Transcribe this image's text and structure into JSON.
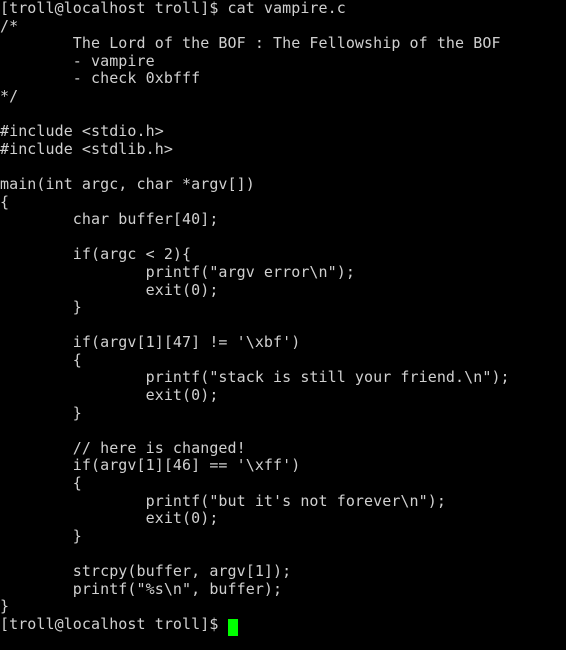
{
  "terminal": {
    "background_color": "#000000",
    "text_color": "#d0d0d0",
    "cursor_color": "#00ff00",
    "prompt": "[troll@localhost troll]$",
    "command": "cat vampire.c",
    "lines": [
      "[troll@localhost troll]$ cat vampire.c",
      "/*",
      "        The Lord of the BOF : The Fellowship of the BOF",
      "        - vampire",
      "        - check 0xbfff",
      "*/",
      "",
      "#include <stdio.h>",
      "#include <stdlib.h>",
      "",
      "main(int argc, char *argv[])",
      "{",
      "        char buffer[40];",
      "",
      "        if(argc < 2){",
      "                printf(\"argv error\\n\");",
      "                exit(0);",
      "        }",
      "",
      "        if(argv[1][47] != '\\xbf')",
      "        {",
      "                printf(\"stack is still your friend.\\n\");",
      "                exit(0);",
      "        }",
      "",
      "        // here is changed!",
      "        if(argv[1][46] == '\\xff')",
      "        {",
      "                printf(\"but it's not forever\\n\");",
      "                exit(0);",
      "        }",
      "",
      "        strcpy(buffer, argv[1]);",
      "        printf(\"%s\\n\", buffer);",
      "}"
    ],
    "final_prompt": "[troll@localhost troll]$ "
  }
}
